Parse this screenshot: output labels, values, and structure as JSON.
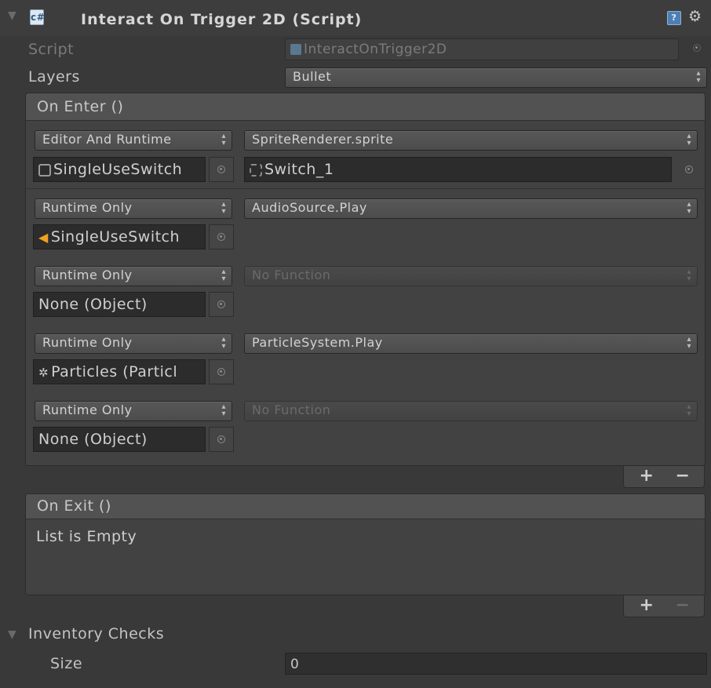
{
  "component": {
    "title": "Interact On Trigger 2D (Script)",
    "icon": "csharp-script-icon",
    "help_icon": "help-book-icon",
    "settings_icon": "gear-icon"
  },
  "fields": {
    "script_label": "Script",
    "script_value": "InteractOnTrigger2D",
    "layers_label": "Layers",
    "layers_value": "Bullet"
  },
  "on_enter": {
    "title": "On Enter ()",
    "entries": [
      {
        "mode": "Editor And Runtime",
        "function": "SpriteRenderer.sprite",
        "object": "SingleUseSwitch",
        "object_icon": "sprite-renderer-icon",
        "argument": "Switch_1",
        "function_enabled": true
      },
      {
        "mode": "Runtime Only",
        "function": "AudioSource.Play",
        "object": "SingleUseSwitch",
        "object_icon": "audio-source-icon",
        "function_enabled": true
      },
      {
        "mode": "Runtime Only",
        "function": "No Function",
        "object": "None (Object)",
        "function_enabled": false
      },
      {
        "mode": "Runtime Only",
        "function": "ParticleSystem.Play",
        "object": "Particles (Particl",
        "object_icon": "particle-system-icon",
        "function_enabled": true
      },
      {
        "mode": "Runtime Only",
        "function": "No Function",
        "object": "None (Object)",
        "function_enabled": false
      }
    ],
    "add": "+",
    "remove": "−"
  },
  "on_exit": {
    "title": "On Exit ()",
    "empty_text": "List is Empty",
    "add": "+",
    "remove": "−"
  },
  "inventory": {
    "label": "Inventory Checks",
    "size_label": "Size",
    "size_value": "0"
  },
  "colors": {
    "background": "#393939",
    "event_header": "#525252",
    "accent_script": "#4d7fb3"
  }
}
